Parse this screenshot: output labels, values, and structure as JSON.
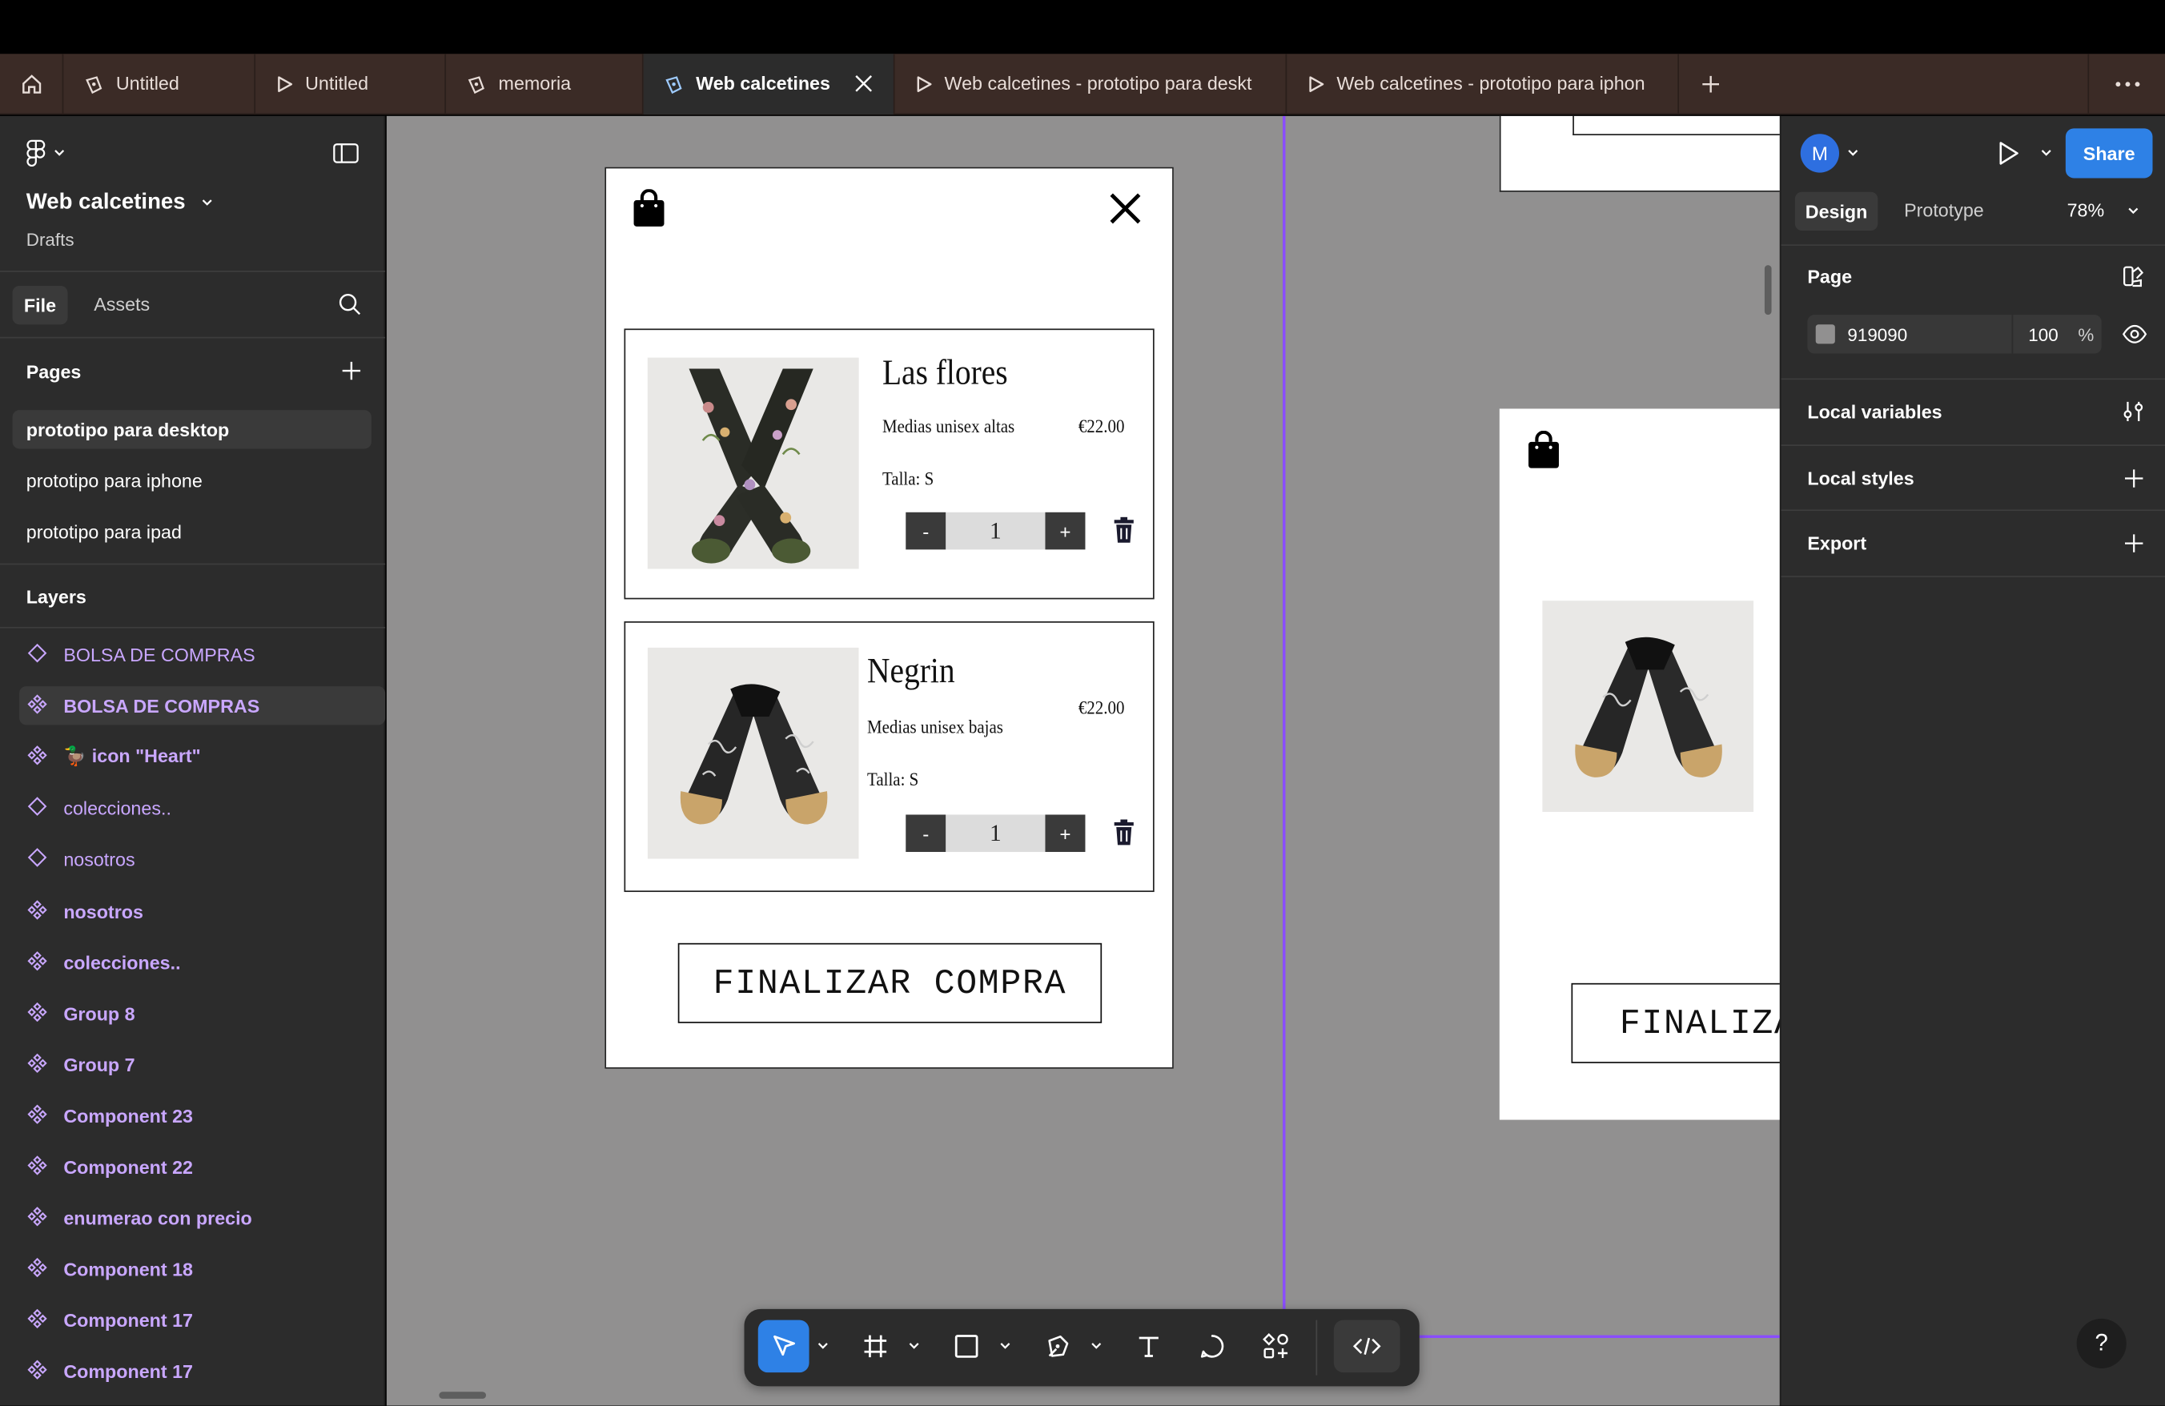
{
  "tabs": [
    {
      "label": "Untitled",
      "icon": "design-file-icon"
    },
    {
      "label": "Untitled",
      "icon": "prototype-play-icon"
    },
    {
      "label": "memoria",
      "icon": "design-file-icon"
    },
    {
      "label": "Web calcetines",
      "icon": "design-file-icon",
      "active": true
    },
    {
      "label": "Web calcetines - prototipo para deskt",
      "icon": "prototype-play-icon"
    },
    {
      "label": "Web calcetines - prototipo para iphon",
      "icon": "prototype-play-icon"
    }
  ],
  "file": {
    "name": "Web calcetines",
    "location": "Drafts"
  },
  "left_tabs": {
    "file": "File",
    "assets": "Assets"
  },
  "pages": {
    "heading": "Pages",
    "items": [
      "prototipo para desktop",
      "prototipo para iphone",
      "prototipo para ipad"
    ]
  },
  "layers": {
    "heading": "Layers",
    "items": [
      {
        "label": "BOLSA DE COMPRAS",
        "kind": "instance"
      },
      {
        "label": "BOLSA DE COMPRAS",
        "kind": "component"
      },
      {
        "label": "🦆 icon \"Heart\"",
        "kind": "component"
      },
      {
        "label": "colecciones..",
        "kind": "instance"
      },
      {
        "label": "nosotros",
        "kind": "instance"
      },
      {
        "label": "nosotros",
        "kind": "component"
      },
      {
        "label": "colecciones..",
        "kind": "component"
      },
      {
        "label": "Group 8",
        "kind": "component"
      },
      {
        "label": "Group 7",
        "kind": "component"
      },
      {
        "label": "Component 23",
        "kind": "component"
      },
      {
        "label": "Component 22",
        "kind": "component"
      },
      {
        "label": "enumerao con precio",
        "kind": "component"
      },
      {
        "label": "Component 18",
        "kind": "component"
      },
      {
        "label": "Component 17",
        "kind": "component"
      },
      {
        "label": "Component 17",
        "kind": "component"
      }
    ]
  },
  "cart": {
    "items": [
      {
        "name": "Las flores",
        "desc": "Medias unisex altas",
        "price": "€22.00",
        "size": "Talla: S",
        "qty": "1"
      },
      {
        "name": "Negrin",
        "desc": "Medias unisex bajas",
        "price": "€22.00",
        "size": "Talla: S",
        "qty": "1"
      }
    ],
    "minus": "-",
    "plus": "+",
    "checkout": "FINALIZAR COMPRA",
    "checkout_cropped": "FINALIZA"
  },
  "right": {
    "avatar": "M",
    "share": "Share",
    "tab_design": "Design",
    "tab_prototype": "Prototype",
    "zoom": "78%",
    "page_heading": "Page",
    "page_color_hex": "919090",
    "page_opacity": "100",
    "percent": "%",
    "local_variables": "Local variables",
    "local_styles": "Local styles",
    "export": "Export",
    "help": "?"
  },
  "colors": {
    "canvas": "#919090",
    "tabbar": "#3b2b26",
    "panel": "#2c2c2c",
    "accent_blue": "#2e81e6",
    "component_purple": "#c9a7ff",
    "guide_purple": "#8a4dff"
  }
}
